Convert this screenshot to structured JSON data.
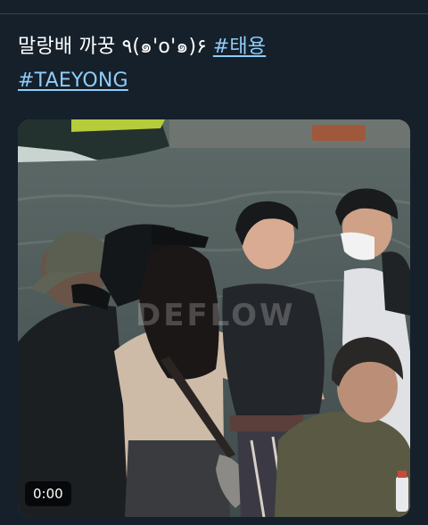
{
  "tweet": {
    "text_line1": "말랑배 까꿍 ٩(๑'o'๑)۶ ",
    "hashtag_1": "#태용",
    "hashtag_2": "#TAEYONG"
  },
  "media": {
    "type": "video",
    "watermark": "DEFLOW",
    "duration": "0:00"
  },
  "colors": {
    "background": "#15202b",
    "hashtag": "#8ecdf8",
    "text": "#ffffff",
    "divider": "#38444d"
  }
}
